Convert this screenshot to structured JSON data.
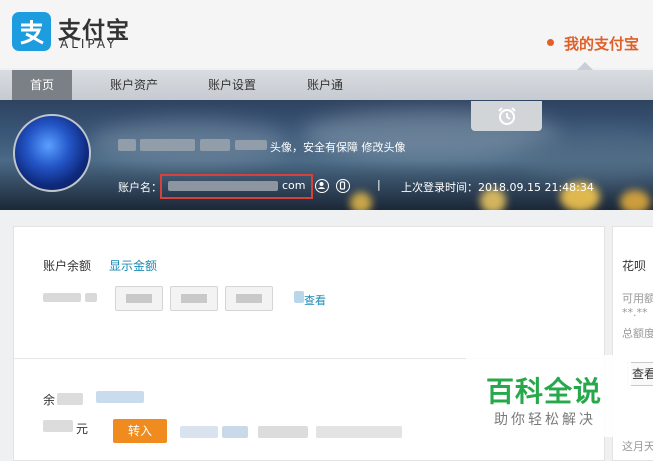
{
  "brand": {
    "logo_cn": "支付宝",
    "logo_en": "ALIPAY",
    "my_alipay": "我的支付宝",
    "color_blue": "#1e9ce0",
    "color_orange": "#e0602a"
  },
  "nav": {
    "items": [
      {
        "label": "首页",
        "active": true
      },
      {
        "label": "账户资产",
        "active": false
      },
      {
        "label": "账户设置",
        "active": false
      },
      {
        "label": "账户通",
        "active": false
      }
    ]
  },
  "profile": {
    "avatar_note": "头像，安全有保障 修改头像",
    "account_label": "账户名：",
    "account_suffix": "com",
    "separator": "|",
    "last_login": "上次登录时间：2018.09.15 21:48:34"
  },
  "balance": {
    "label": "账户余额",
    "show_link": "显示金额",
    "view_link": "查看"
  },
  "yuebao": {
    "label": "余",
    "yuan": "元",
    "transfer_in": "转入"
  },
  "huabei": {
    "title": "花呗",
    "available": "可用额",
    "masked": "**.**",
    "total": "总额度",
    "view_button": "查看",
    "month": "这月天"
  },
  "watermark": {
    "main": "百科全说",
    "sub": "助你轻松解决",
    "color": "#27a84a"
  }
}
